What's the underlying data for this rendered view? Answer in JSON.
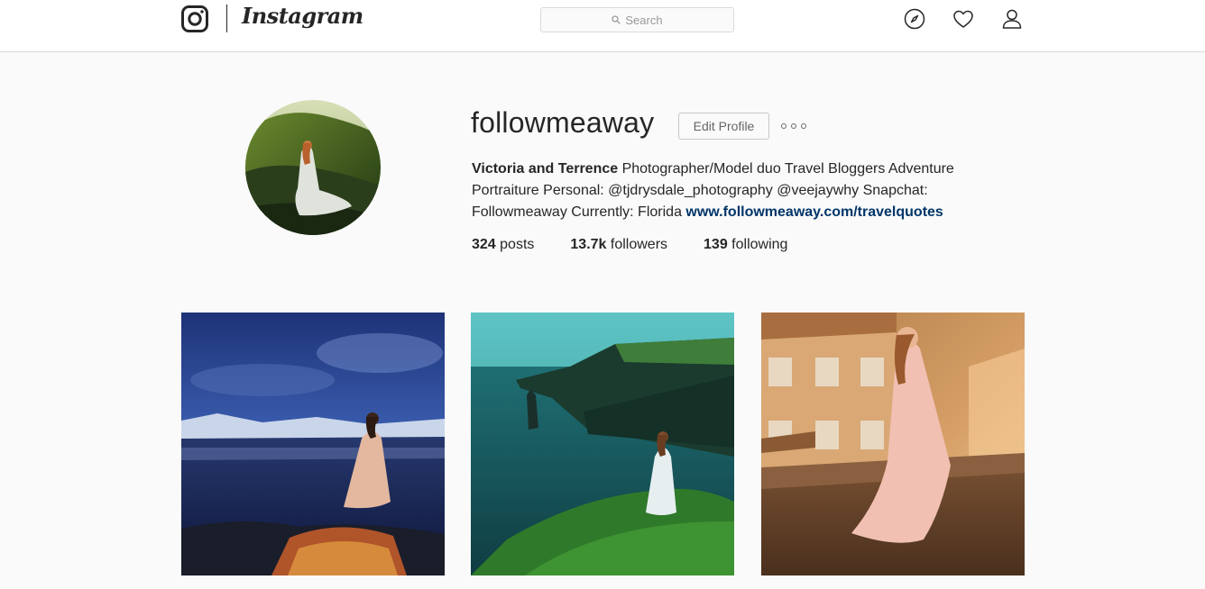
{
  "header": {
    "wordmark": "Instagram",
    "search_placeholder": "Search",
    "icons": [
      "instagram-glyph-icon",
      "search-icon",
      "compass-icon",
      "heart-icon",
      "person-icon"
    ]
  },
  "profile": {
    "username": "followmeaway",
    "edit_label": "Edit Profile",
    "bio": {
      "name": "Victoria and Terrence",
      "text": " Photographer/Model duo Travel Bloggers Adventure Portraiture Personal: @tjdrysdale_photography @veejaywhy Snapchat: Followmeaway Currently: Florida ",
      "link": "www.followmeaway.com/travelquotes"
    },
    "stats": [
      {
        "count": "324",
        "label": " posts"
      },
      {
        "count": "13.7k",
        "label": " followers"
      },
      {
        "count": "139",
        "label": " following"
      }
    ]
  },
  "posts": [
    {
      "subject": "woman in dress on rocky shore at dusk"
    },
    {
      "subject": "woman in white dress on sea cliffs"
    },
    {
      "subject": "woman in pink dress on sunny ledge"
    }
  ],
  "colors": {
    "link": "#003569",
    "border": "#dbdbdb",
    "background": "#fafafa"
  }
}
